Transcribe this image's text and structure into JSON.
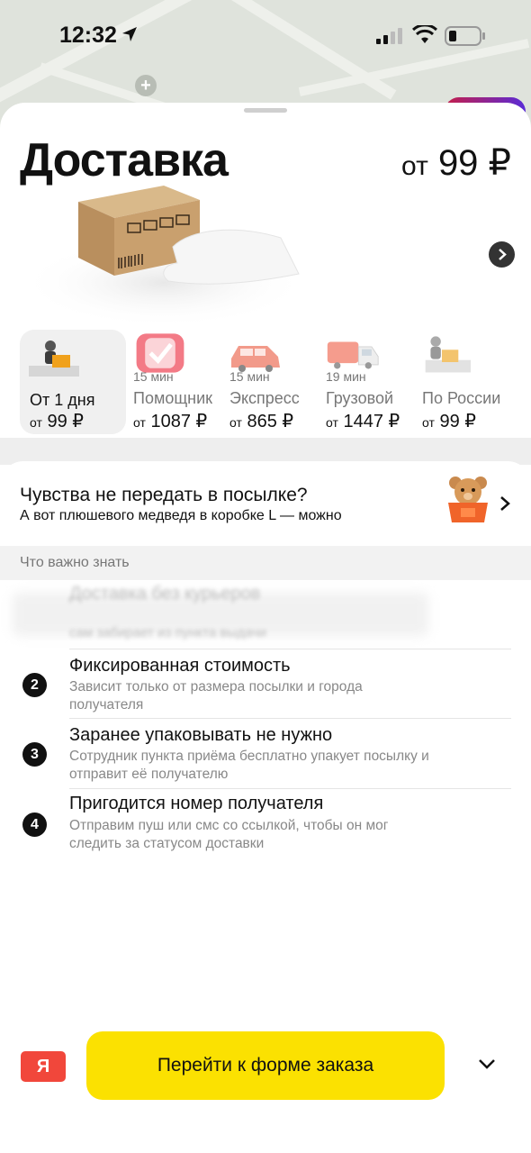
{
  "status_bar": {
    "time": "12:32"
  },
  "sheet": {
    "title": "Доставка",
    "price_prefix": "от",
    "price_value": "99 ₽"
  },
  "tariffs": [
    {
      "eta": "",
      "name": "От 1 дня",
      "cost_prefix": "от",
      "cost": "99 ₽",
      "icon": "pickup-point-icon",
      "active": true
    },
    {
      "eta": "15 мин",
      "name": "Помощник",
      "cost_prefix": "от",
      "cost": "1087 ₽",
      "icon": "checkmark-helper-icon",
      "active": false
    },
    {
      "eta": "15 мин",
      "name": "Экспресс",
      "cost_prefix": "от",
      "cost": "865 ₽",
      "icon": "express-car-icon",
      "active": false
    },
    {
      "eta": "19 мин",
      "name": "Грузовой",
      "cost_prefix": "от",
      "cost": "1447 ₽",
      "icon": "cargo-truck-icon",
      "active": false
    },
    {
      "eta": "",
      "name": "По России",
      "cost_prefix": "от",
      "cost": "99 ₽",
      "icon": "russia-delivery-icon",
      "active": false
    }
  ],
  "promo": {
    "headline": "Чувства не передать в посылке?",
    "subtitle": "А вот плюшевого медведя в коробке L — можно"
  },
  "info_section": {
    "header": "Что важно знать",
    "items": [
      {
        "num": "1",
        "title": "Доставка без курьеров",
        "desc": "сам забирает из пункта выдачи"
      },
      {
        "num": "2",
        "title": "Фиксированная стоимость",
        "desc": "Зависит только от размера посылки и города получателя"
      },
      {
        "num": "3",
        "title": "Заранее упаковывать не нужно",
        "desc": "Сотрудник пункта приёма бесплатно упакует посылку и отправит её получателю"
      },
      {
        "num": "4",
        "title": "Пригодится номер получателя",
        "desc": "Отправим пуш или смс со ссылкой, чтобы он мог следить за статусом доставки"
      }
    ]
  },
  "bottom": {
    "logo": "Я",
    "cta_label": "Перейти к форме заказа"
  }
}
